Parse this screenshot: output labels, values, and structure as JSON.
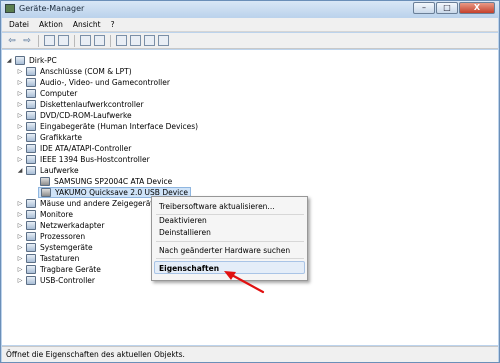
{
  "window": {
    "title": "Geräte-Manager"
  },
  "title_buttons": {
    "minimize": "–",
    "maximize": "□",
    "close": "X"
  },
  "menu": [
    "Datei",
    "Aktion",
    "Ansicht",
    "?"
  ],
  "toolbar": {
    "back": "⇦",
    "forward": "⇨"
  },
  "tree": {
    "root": "Dirk-PC",
    "items": [
      "Anschlüsse (COM & LPT)",
      "Audio-, Video- und Gamecontroller",
      "Computer",
      "Diskettenlaufwerkcontroller",
      "DVD/CD-ROM-Laufwerke",
      "Eingabegeräte (Human Interface Devices)",
      "Grafikkarte",
      "IDE ATA/ATAPI-Controller",
      "IEEE 1394 Bus-Hostcontroller",
      "Laufwerke"
    ],
    "laufwerke_children": [
      "SAMSUNG SP2004C ATA Device",
      "YAKUMO Quicksave 2.0 USB Device"
    ],
    "items_after": [
      "Mäuse und andere Zeigegeräte",
      "Monitore",
      "Netzwerkadapter",
      "Prozessoren",
      "Systemgeräte",
      "Tastaturen",
      "Tragbare Geräte",
      "USB-Controller"
    ]
  },
  "context_menu": {
    "update": "Treibersoftware aktualisieren...",
    "disable": "Deaktivieren",
    "uninstall": "Deinstallieren",
    "scan": "Nach geänderter Hardware suchen",
    "properties": "Eigenschaften"
  },
  "status": "Öffnet die Eigenschaften des aktuellen Objekts.",
  "colors": {
    "selection": "#cfe3f8",
    "annotation_arrow": "#e01010"
  }
}
